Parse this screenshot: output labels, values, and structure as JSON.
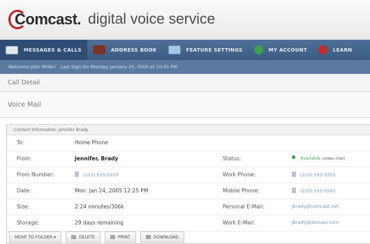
{
  "header": {
    "brand": "Comcast.",
    "subtitle": "digital voice service"
  },
  "nav": {
    "items": [
      {
        "label": "MESSAGES & CALLS",
        "icon": "mail-icon"
      },
      {
        "label": "ADDRESS BOOK",
        "icon": "address-book-icon"
      },
      {
        "label": "FEATURE SETTINGS",
        "icon": "feature-settings-icon"
      },
      {
        "label": "MY ACCOUNT",
        "icon": "my-account-icon"
      },
      {
        "label": "LEARN",
        "icon": "learn-icon"
      }
    ],
    "active": "MESSAGES & CALLS"
  },
  "welcome": {
    "greeting": "Welcome John Miller!",
    "last_sign_on": "Last Sign On Monday January 25, 2005 at 10:45 PM"
  },
  "sections": {
    "call_detail": "Call Detail",
    "voice_mail": "Voice Mail"
  },
  "contact": {
    "header": "Contact Information: Jennifer Brady",
    "to_label": "To:",
    "to_value": "Home Phone",
    "from_label": "From:",
    "from_value": "Jennifer, Brady",
    "from_number_label": "From Number:",
    "from_number_value": "(215) 555-5555",
    "date_label": "Date:",
    "date_value": "Mon. Jan 24, 2005 12:25 PM",
    "size_label": "Size:",
    "size_value": "2:24 minutes/306k",
    "storage_label": "Storage:",
    "storage_value": "29 days remaining",
    "status_label": "Status:",
    "status_value": "Available",
    "status_note": "(video chat)",
    "work_phone_label": "Work Phone:",
    "work_phone_value": "(215) 555-5555",
    "mobile_phone_label": "Mobile Phone:",
    "mobile_phone_value": "(215) 555-5555",
    "personal_email_label": "Personal E-Mail:",
    "personal_email_value": "jbrady@comcast.net",
    "work_email_label": "Work E-Mail:",
    "work_email_value": "jbrady@domain.com"
  },
  "actions": {
    "move": "MOVE TO FOLDER",
    "move_arrow": "▾",
    "delete": "DELETE",
    "print": "PRINT",
    "download": "DOWNLOAD"
  },
  "colors": {
    "nav": "#3f6089",
    "welcome_bar": "#5a7aa0",
    "brand_red": "#b8232a",
    "link": "#6f8fb8",
    "available": "#2ea63b"
  }
}
